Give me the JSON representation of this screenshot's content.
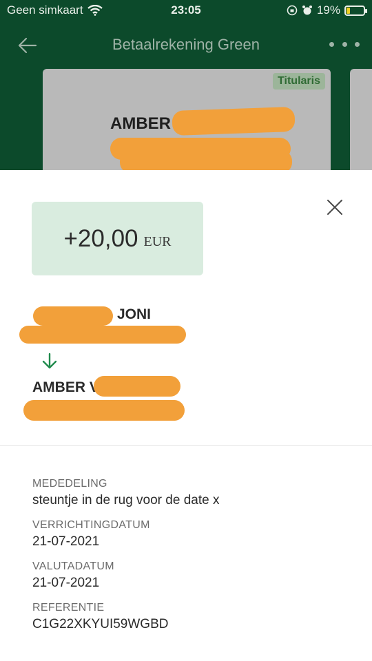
{
  "status": {
    "carrier": "Geen simkaart",
    "time": "23:05",
    "battery": "19%",
    "icons": [
      "wifi-icon",
      "lock-rotation-icon",
      "alarm-icon",
      "battery-icon"
    ]
  },
  "header": {
    "title": "Betaalrekening Green",
    "back_icon": "arrow-left-icon",
    "more_icon": "more-dots-icon"
  },
  "card": {
    "badge": "Titularis",
    "holder": "AMBER V"
  },
  "transaction": {
    "amount": "+20,00",
    "currency": "EUR",
    "sender": "JONI",
    "recipient": "AMBER V"
  },
  "details": {
    "mededeling_label": "MEDEDELING",
    "mededeling": "steuntje in de rug voor de date x",
    "verrichtingsdatum_label": "VERRICHTINGDATUM",
    "verrichtingsdatum": "21-07-2021",
    "valutadatum_label": "VALUTADATUM",
    "valutadatum": "21-07-2021",
    "referentie_label": "REFERENTIE",
    "referentie": "C1G22XKYUI59WGBD"
  },
  "colors": {
    "header_bg": "#0c4a2b",
    "amount_bg": "#d9ecdf",
    "arrow": "#1f8a4c",
    "redaction": "#f2a03a"
  }
}
